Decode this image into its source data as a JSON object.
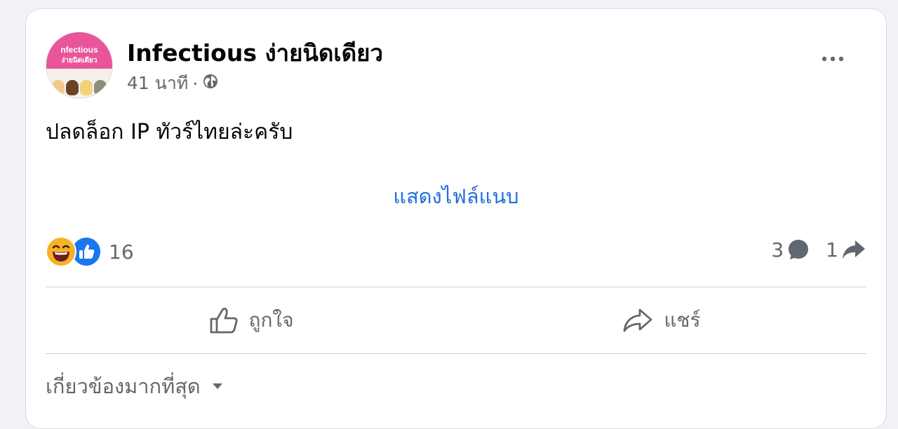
{
  "post": {
    "avatar": {
      "line1": "nfectious",
      "line2": "ง่ายนิดเดียว"
    },
    "page_name": "Infectious ง่ายนิดเดียว",
    "time": "41 นาที",
    "separator": "·",
    "privacy_icon": "globe-icon",
    "more_icon": "more-options-icon",
    "text": "ปลดล็อก IP ทัวร์ไทยล่ะครับ",
    "attachment_link": "แสดงไฟล์แนบ"
  },
  "engagement": {
    "reaction_icons": [
      "haha-icon",
      "like-icon"
    ],
    "reaction_count": "16",
    "comment_count": "3",
    "comment_icon": "comment-icon",
    "share_count": "1",
    "share_icon": "share-icon"
  },
  "actions": {
    "like_label": "ถูกใจ",
    "like_icon": "thumbs-up-icon",
    "share_label": "แชร์",
    "share_icon": "share-arrow-icon"
  },
  "comments": {
    "sort_label": "เกี่ยวข้องมากที่สุด",
    "sort_icon": "caret-down-icon"
  },
  "colors": {
    "link_blue": "#216fdb",
    "like_blue": "#1877f2",
    "haha_yellow": "#f7b125",
    "secondary_text": "#65676b",
    "avatar_pink": "#e8559a"
  }
}
